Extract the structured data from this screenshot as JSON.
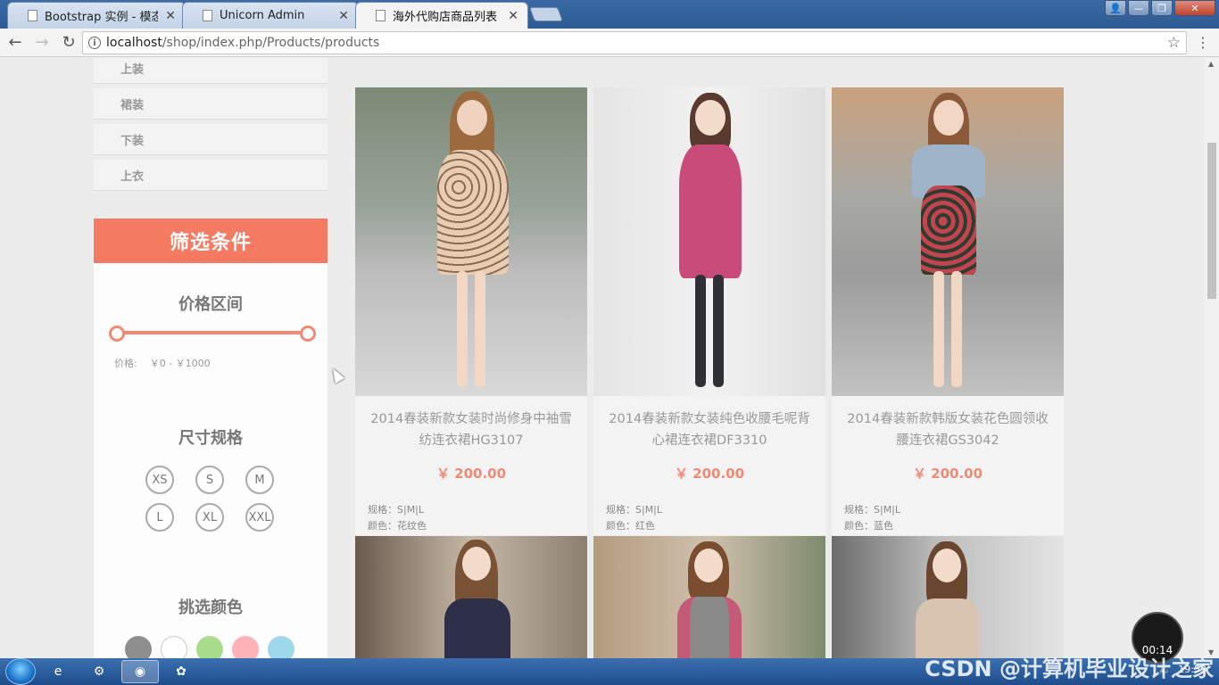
{
  "browser": {
    "tabs": [
      {
        "title": "Bootstrap 实例 - 模态框"
      },
      {
        "title": "Unicorn Admin"
      },
      {
        "title": "海外代购店商品列表"
      }
    ],
    "url_host": "localhost",
    "url_path": "/shop/index.php/Products/products"
  },
  "sidebar": {
    "categories": [
      "上装",
      "裙装",
      "下装",
      "上衣"
    ]
  },
  "filter": {
    "header": "筛选条件",
    "price_title": "价格区间",
    "price_label": "价格:",
    "price_range": "￥0 - ￥1000",
    "price_min": 0,
    "price_max": 1000,
    "size_title": "尺寸规格",
    "sizes": [
      "XS",
      "S",
      "M",
      "L",
      "XL",
      "XXL"
    ],
    "color_title": "挑选颜色",
    "colors": [
      "#8e8e8e",
      "#ffffff",
      "#a9dc8c",
      "#ffb3b8",
      "#9fd8ea"
    ],
    "accent": "#f47a62"
  },
  "products": [
    {
      "name": "2014春装新款女装时尚修身中袖雪纺连衣裙HG3107",
      "price": "￥ 200.00",
      "size": "规格：S|M|L",
      "color": "颜色：花纹色"
    },
    {
      "name": "2014春装新款女装纯色收腰毛呢背心裙连衣裙DF3310",
      "price": "￥ 200.00",
      "size": "规格：S|M|L",
      "color": "颜色：红色"
    },
    {
      "name": "2014春装新款韩版女装花色圆领收腰连衣裙GS3042",
      "price": "￥ 200.00",
      "size": "规格：S|M|L",
      "color": "颜色：蓝色"
    }
  ],
  "overlay": {
    "timer": "00:14",
    "watermark": "CSDN @计算机毕业设计之家",
    "clock": "19:53"
  }
}
